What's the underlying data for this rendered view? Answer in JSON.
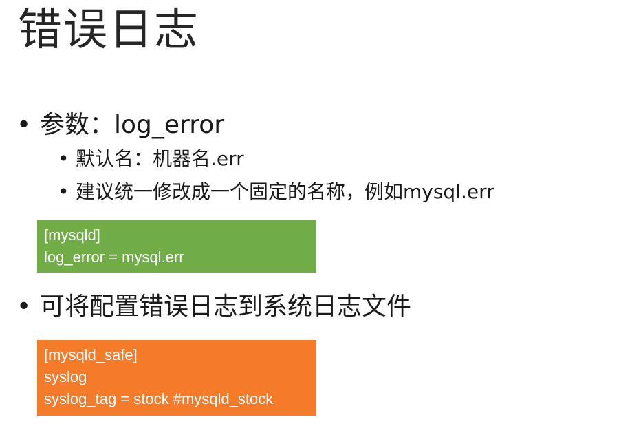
{
  "slide": {
    "title": "错误日志",
    "bullet_char": "•",
    "bullets": [
      {
        "text": "参数：log_error",
        "sub": [
          "默认名：机器名.err",
          "建议统一修改成一个固定的名称，例如mysql.err"
        ]
      },
      {
        "text": "可将配置错误日志到系统日志文件"
      }
    ],
    "code_blocks": [
      {
        "color": "#70ad47",
        "lines": [
          "[mysqld]",
          "log_error = mysql.err"
        ]
      },
      {
        "color": "#f47b2a",
        "lines": [
          "[mysqld_safe]",
          "syslog",
          "syslog_tag = stock #mysqld_stock"
        ]
      }
    ]
  }
}
